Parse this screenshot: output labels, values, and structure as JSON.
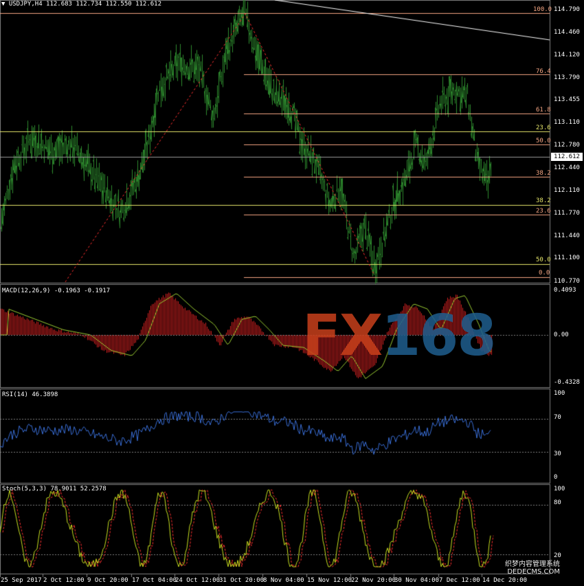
{
  "header": {
    "symbol": "USDJPY,H4",
    "ohlc": "112.683 112.734 112.550 112.612"
  },
  "panels": {
    "macd": {
      "label": "MACD(12,26,9) -0.1963 -0.1917",
      "axis": [
        "0.4093",
        "0.00",
        "-0.4328"
      ]
    },
    "rsi": {
      "label": "RSI(14) 46.3898",
      "axis": [
        "100",
        "70",
        "30",
        "0"
      ]
    },
    "stoch": {
      "label": "Stoch(5,3,3) 78.9011 52.2578",
      "axis": [
        "100",
        "80",
        "20"
      ]
    }
  },
  "price_axis": [
    "114.790",
    "114.460",
    "114.120",
    "113.790",
    "113.455",
    "113.110",
    "112.780",
    "112.440",
    "112.110",
    "111.770",
    "111.440",
    "111.100",
    "110.770"
  ],
  "current_price": "112.612",
  "fib_labels": {
    "upper": [
      "100.0",
      "76.4",
      "61.8",
      "50.0",
      "38.2",
      "23.6",
      "0.0"
    ],
    "yellow": [
      "23.6",
      "38.2",
      "50.0"
    ]
  },
  "x_axis": [
    "25 Sep 2017",
    "2 Oct 12:00",
    "9 Oct 20:00",
    "17 Oct 04:00",
    "24 Oct 12:00",
    "31 Oct 20:00",
    "8 Nov 04:00",
    "15 Nov 12:00",
    "22 Nov 20:00",
    "30 Nov 04:00",
    "7 Dec 12:00",
    "14 Dec 20:00"
  ],
  "watermark": {
    "part1": "FX",
    "part2": "168"
  },
  "site_text": {
    "line1": "织梦内容管理系统",
    "line2": "DEDECMS.COM"
  },
  "colors": {
    "bull": "#2e8b2e",
    "macd_hist": "#d02020",
    "macd_signal": "#9acd32",
    "rsi": "#3a6fd8",
    "stoch_main": "#c8e020",
    "stoch_signal": "#ff3030",
    "fib_upper": "#f4a582",
    "fib_yellow": "#e6e66a",
    "zigzag": "#ff3030"
  },
  "chart_data": {
    "type": "line",
    "title": "USDJPY,H4",
    "series": [
      {
        "name": "USDJPY",
        "x": [
          "25 Sep 2017",
          "2 Oct 12:00",
          "9 Oct 20:00",
          "17 Oct 04:00",
          "24 Oct 12:00",
          "31 Oct 20:00",
          "8 Nov 04:00",
          "15 Nov 12:00",
          "22 Nov 20:00",
          "30 Nov 04:00",
          "7 Dec 12:00",
          "14 Dec 20:00"
        ],
        "values": [
          112.3,
          112.9,
          112.5,
          111.9,
          113.9,
          114.75,
          113.4,
          112.6,
          111.1,
          112.6,
          113.7,
          112.6
        ]
      }
    ],
    "ylim": [
      110.77,
      114.79
    ]
  }
}
